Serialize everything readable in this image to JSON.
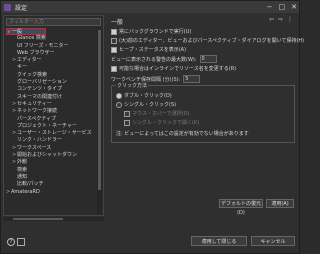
{
  "window": {
    "title": "設定"
  },
  "filter": {
    "placeholder": "フィルター入力"
  },
  "tree": [
    {
      "label": "一般",
      "twisty": "∨",
      "indent": 0,
      "selected": true
    },
    {
      "label": "Glance 検索",
      "twisty": "",
      "indent": 1
    },
    {
      "label": "UI フリーズ・モニター",
      "twisty": "",
      "indent": 1
    },
    {
      "label": "Web ブラウザー",
      "twisty": "",
      "indent": 1
    },
    {
      "label": "エディター",
      "twisty": ">",
      "indent": 1
    },
    {
      "label": "キー",
      "twisty": "",
      "indent": 1
    },
    {
      "label": "クイック検索",
      "twisty": "",
      "indent": 1
    },
    {
      "label": "グローバリゼーション",
      "twisty": "",
      "indent": 1
    },
    {
      "label": "コンテンツ・タイプ",
      "twisty": "",
      "indent": 1
    },
    {
      "label": "スキーマの関連付け",
      "twisty": "",
      "indent": 1
    },
    {
      "label": "セキュリティー",
      "twisty": ">",
      "indent": 1
    },
    {
      "label": "ネットワーク接続",
      "twisty": ">",
      "indent": 1
    },
    {
      "label": "パースペクティブ",
      "twisty": "",
      "indent": 1
    },
    {
      "label": "プロジェクト・ネーチャー",
      "twisty": "",
      "indent": 1
    },
    {
      "label": "ユーザー・ストレージ・サービス",
      "twisty": ">",
      "indent": 1
    },
    {
      "label": "リンク・ハンドラー",
      "twisty": "",
      "indent": 1
    },
    {
      "label": "ワークスペース",
      "twisty": ">",
      "indent": 1
    },
    {
      "label": "開始およびシャットダウン",
      "twisty": ">",
      "indent": 1
    },
    {
      "label": "外観",
      "twisty": ">",
      "indent": 1
    },
    {
      "label": "検索",
      "twisty": "",
      "indent": 1
    },
    {
      "label": "通知",
      "twisty": "",
      "indent": 1
    },
    {
      "label": "比較/パッチ",
      "twisty": "",
      "indent": 1
    },
    {
      "label": "AmateraRD",
      "twisty": ">",
      "indent": 0
    }
  ],
  "main": {
    "heading": "一般",
    "options": [
      {
        "label": "常にバックグラウンドで実行(U)",
        "checked": true
      },
      {
        "label": "(大)前のエディター、ビューおよびパースペクティブ・ダイアログを開いて保持(H)",
        "checked": false
      },
      {
        "label": "ヒープ・ステータスを表示(A)",
        "checked": true
      },
      {
        "label": "ビューに表示される警告の最大数(W):",
        "value": "0"
      },
      {
        "label": "可能な場合はインラインでリソース名を変更する(R)",
        "checked": true
      },
      {
        "label": "ワークベンチ保存間隔 (分)(S):",
        "value": "5"
      }
    ],
    "click_group": {
      "title": "クリック方法",
      "options": [
        {
          "label": "ダブル・クリック(D)",
          "on": true,
          "dim": false
        },
        {
          "label": "シングル・クリック(S)",
          "on": false,
          "dim": false
        },
        {
          "label": "マウス・ホバーで選択(O)",
          "dim": true
        },
        {
          "label": "シングル・クリックで開く(K)",
          "dim": true
        }
      ],
      "note": "注: ビューによってはこの設定が有効でない場合があります"
    },
    "restore_defaults": "デフォルトの復元(D)",
    "apply": "適用(A)"
  },
  "footer": {
    "apply_close": "適用して閉じる",
    "cancel": "キャンセル"
  }
}
